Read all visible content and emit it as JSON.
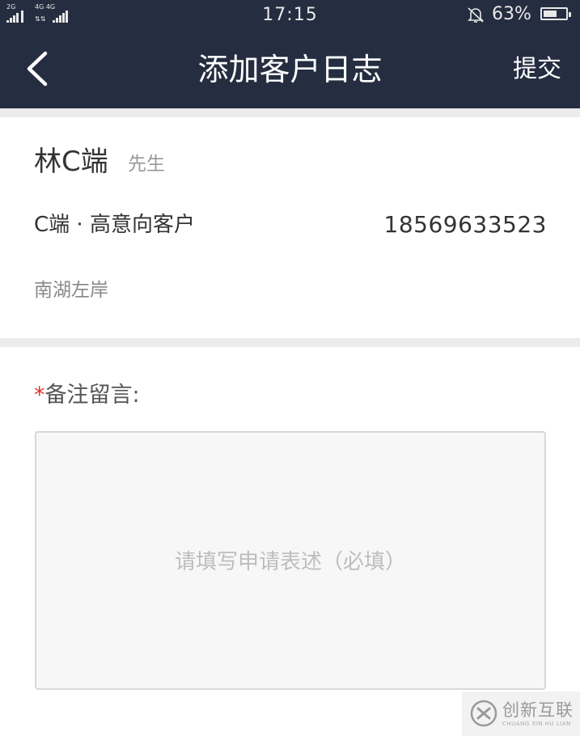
{
  "status_bar": {
    "network_left": "2G",
    "network_right": "4G 4G",
    "time": "17:15",
    "battery_percent": "63%",
    "battery_level": 0.63
  },
  "header": {
    "title": "添加客户日志",
    "submit_label": "提交"
  },
  "customer": {
    "name": "林C端",
    "salutation": "先生",
    "tags": "C端 · 高意向客户",
    "phone": "18569633523",
    "address": "南湖左岸"
  },
  "remark": {
    "required_mark": "*",
    "label": "备注留言:",
    "value": "",
    "placeholder": "请填写申请表述（必填）"
  },
  "watermark": {
    "text": "创新互联",
    "subtext": "CHUANG XIN HU LIAN"
  },
  "colors": {
    "header_bg": "#252d40",
    "required": "#e0302d",
    "divider": "#ececec"
  }
}
